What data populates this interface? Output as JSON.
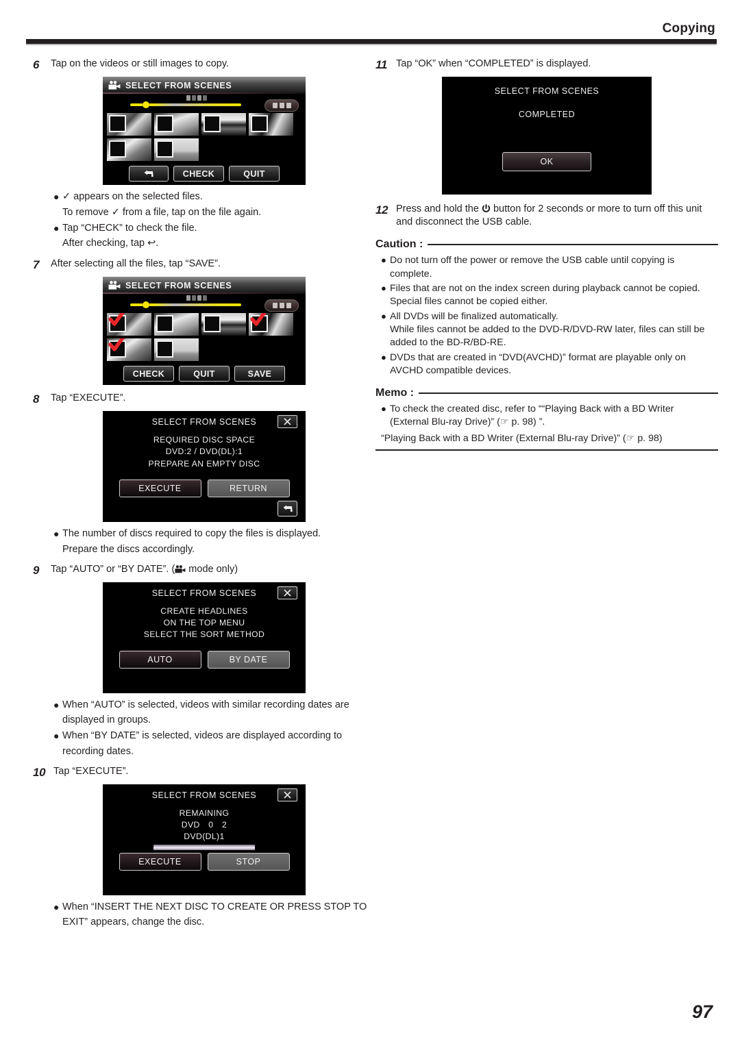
{
  "header": {
    "title": "Copying"
  },
  "page_number": "97",
  "left_column": {
    "step6": {
      "num": "6",
      "text": "Tap on the videos or still images to copy.",
      "screen": {
        "title": "SELECT FROM SCENES",
        "icon": "camcorder-icon",
        "buttons": [
          "back-arrow",
          "CHECK",
          "QUIT"
        ],
        "thumbnail_count": 6,
        "checked_count": 0
      },
      "bullets": [
        {
          "dot": "●",
          "text": "✓ appears on the selected files.",
          "sub": "To remove ✓ from a file, tap on the file again."
        },
        {
          "dot": "●",
          "text": "Tap “CHECK” to check the file.",
          "sub": "After checking, tap ↩."
        }
      ]
    },
    "step7": {
      "num": "7",
      "text": "After selecting all the files, tap “SAVE”.",
      "screen": {
        "title": "SELECT FROM SCENES",
        "icon": "camcorder-icon",
        "buttons": [
          "CHECK",
          "QUIT",
          "SAVE"
        ],
        "thumbnail_count": 6,
        "checked_indices": [
          0,
          3,
          4
        ]
      }
    },
    "step8": {
      "num": "8",
      "text": "Tap “EXECUTE”.",
      "screen": {
        "title": "SELECT FROM SCENES",
        "close": "close-icon",
        "lines": [
          "REQUIRED DISC SPACE",
          "DVD:2 / DVD(DL):1",
          "PREPARE AN EMPTY DISC"
        ],
        "primary_button": "EXECUTE",
        "secondary_button": "RETURN",
        "back_button": "back-arrow"
      },
      "bullets": [
        {
          "dot": "●",
          "text": "The number of discs required to copy the files is displayed.",
          "sub": "Prepare the discs accordingly."
        }
      ]
    },
    "step9": {
      "num": "9",
      "text_before": "Tap “AUTO” or “BY DATE”. (",
      "text_after": " mode only)",
      "screen": {
        "title": "SELECT FROM SCENES",
        "close": "close-icon",
        "lines": [
          "CREATE HEADLINES",
          "ON THE TOP MENU",
          "SELECT THE SORT METHOD"
        ],
        "primary_button": "AUTO",
        "secondary_button": "BY DATE"
      },
      "bullets": [
        {
          "dot": "●",
          "text": "When “AUTO” is selected, videos with similar recording dates are",
          "sub": "displayed in groups."
        },
        {
          "dot": "●",
          "text": "When “BY DATE” is selected, videos are displayed according to",
          "sub": "recording dates."
        }
      ]
    },
    "step10": {
      "num": "10",
      "text": "Tap “EXECUTE”.",
      "screen": {
        "title": "SELECT FROM SCENES",
        "close": "close-icon",
        "lines": [
          "REMAINING",
          "DVD　0　2",
          "DVD(DL)1"
        ],
        "progress_bar": true,
        "primary_button": "EXECUTE",
        "secondary_button": "STOP"
      },
      "bullets": [
        {
          "dot": "●",
          "text": "When “INSERT THE NEXT DISC TO CREATE OR PRESS STOP TO",
          "sub": "EXIT” appears, change the disc."
        }
      ]
    }
  },
  "right_column": {
    "step11": {
      "num": "11",
      "text": "Tap “OK” when “COMPLETED” is displayed.",
      "screen": {
        "title": "SELECT FROM SCENES",
        "status": "COMPLETED",
        "button": "OK"
      }
    },
    "step12": {
      "num": "12",
      "text_before": "Press and hold the ",
      "icon": "power-icon",
      "text_after": " button for 2 seconds or more to turn off this unit",
      "line2": "and disconnect the USB cable."
    },
    "caution": {
      "label": "Caution :",
      "items": [
        {
          "dot": "●",
          "lines": [
            "Do not turn off the power or remove the USB cable until copying is",
            "complete."
          ]
        },
        {
          "dot": "●",
          "lines": [
            "Files that are not on the index screen during playback cannot be copied.",
            "Special files cannot be copied either."
          ]
        },
        {
          "dot": "●",
          "lines": [
            "All DVDs will be finalized automatically.",
            "While files cannot be added to the DVD-R/DVD-RW later, files can still be",
            "added to the BD-R/BD-RE."
          ]
        },
        {
          "dot": "●",
          "lines": [
            "DVDs that are created in “DVD(AVCHD)” format are playable only on",
            "AVCHD compatible devices."
          ]
        }
      ]
    },
    "memo": {
      "label": "Memo :",
      "items": [
        {
          "dot": "●",
          "lines": [
            "To check the created disc, refer to ““Playing Back with a BD Writer",
            "(External Blu-ray Drive)” (☞ p. 98) ”."
          ]
        }
      ],
      "footer": "“Playing Back with a BD Writer (External Blu-ray Drive)” (☞ p. 98)"
    }
  }
}
